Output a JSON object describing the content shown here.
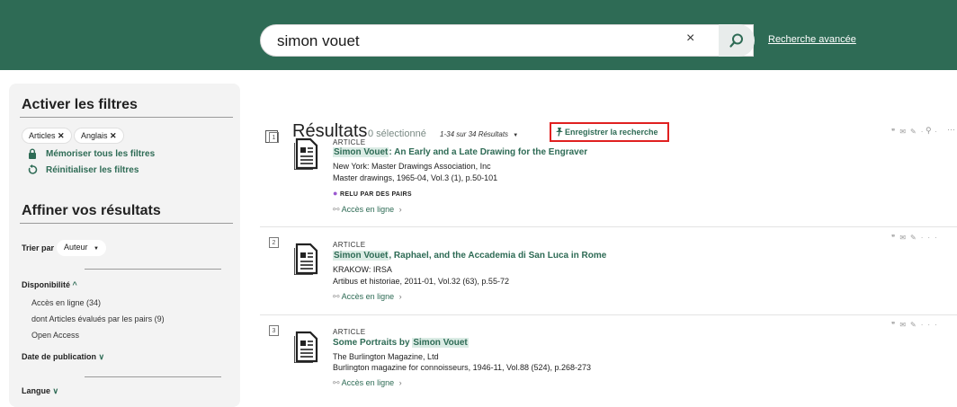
{
  "search": {
    "query": "simon vouet",
    "clear_label": "×",
    "advanced_label": "Recherche avancée"
  },
  "sidebar": {
    "activate_title": "Activer les filtres",
    "chips": [
      {
        "label": "Articles"
      },
      {
        "label": "Anglais"
      }
    ],
    "memorize_label": "Mémoriser tous les filtres",
    "reset_label": "Réinitialiser les filtres",
    "refine_title": "Affiner vos résultats",
    "sort_label": "Trier par",
    "sort_value": "Auteur",
    "availability_label": "Disponibilité",
    "availability_items": [
      "Accès en ligne (34)",
      "dont Articles évalués par les pairs (9)",
      "Open Access"
    ],
    "date_label": "Date de publication",
    "language_label": "Langue"
  },
  "results": {
    "title": "Résultats",
    "selected": "0 sélectionné",
    "range": "1-34 sur 34 Résultats",
    "save_label": "Enregistrer la recherche",
    "items": [
      {
        "num": "1",
        "type": "ARTICLE",
        "title_hl": "Simon Vouet",
        "title_rest": ": An Early and a Late Drawing for the Engraver",
        "publisher": "New York: Master Drawings Association, Inc",
        "source": "Master drawings, 1965-04, Vol.3 (1), p.50-101",
        "peer": "RELU PAR DES PAIRS",
        "access": "Accès en ligne"
      },
      {
        "num": "2",
        "type": "ARTICLE",
        "title_hl": "Simon Vouet",
        "title_rest": ", Raphael, and the Accademia di San Luca in Rome",
        "publisher": "KRAKOW: IRSA",
        "source": "Artibus et historiae, 2011-01, Vol.32 (63), p.55-72",
        "access": "Accès en ligne"
      },
      {
        "num": "3",
        "type": "ARTICLE",
        "title_pre": "Some Portraits by ",
        "title_hl": "Simon Vouet",
        "publisher": "The Burlington Magazine, Ltd",
        "source": "Burlington magazine for connoisseurs, 1946-11, Vol.88 (524), p.268-273",
        "access": "Accès en ligne"
      }
    ]
  },
  "colors": {
    "header": "#2e6b55",
    "accent": "#2e6b55",
    "highlight": "#dbece5",
    "save_border": "#e02020"
  }
}
